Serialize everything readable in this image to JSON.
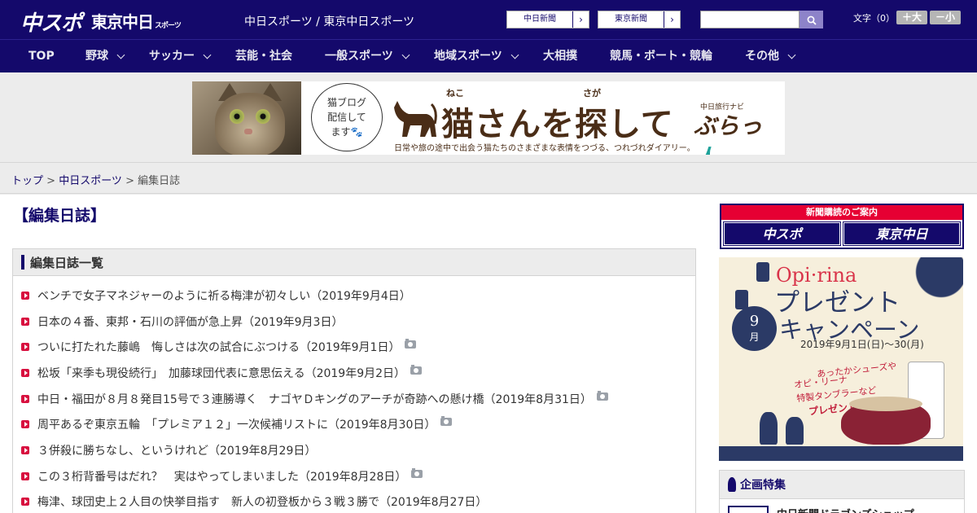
{
  "header": {
    "logo_chuspo": "中スポ",
    "logo_tokyo": "東京中日",
    "logo_tokyo_sub": "スポーツ",
    "site_title": "中日スポーツ / 東京中日スポーツ",
    "paper_links": [
      "中日新聞",
      "東京新聞"
    ],
    "search_placeholder": "",
    "font_size_label": "文字（0）",
    "font_bigger": "＋大",
    "font_smaller": "－小"
  },
  "nav": {
    "items": [
      {
        "label": "TOP",
        "dropdown": false
      },
      {
        "label": "野球",
        "dropdown": true
      },
      {
        "label": "サッカー",
        "dropdown": true
      },
      {
        "label": "芸能・社会",
        "dropdown": false
      },
      {
        "label": "一般スポーツ",
        "dropdown": true
      },
      {
        "label": "地域スポーツ",
        "dropdown": true
      },
      {
        "label": "大相撲",
        "dropdown": false
      },
      {
        "label": "競馬・ボート・競輪",
        "dropdown": false
      },
      {
        "label": "その他",
        "dropdown": true
      }
    ]
  },
  "banner": {
    "bubble_line1": "猫ブログ",
    "bubble_line2": "配信して",
    "bubble_line3": "ます🐾",
    "title": "猫さんを探して",
    "ruby_neko": "ねこ",
    "ruby_saga": "さが",
    "subtitle": "日常や旅の途中で出会う猫たちのさまざまな表情をつづる、つれづれダイアリー。",
    "nav_label": "中日旅行ナビ",
    "brand_a": "ぶらっ",
    "brand_b": "人"
  },
  "breadcrumb": {
    "top": "トップ",
    "section": "中日スポーツ",
    "current": "編集日誌",
    "sep": " > "
  },
  "main": {
    "title": "【編集日誌】",
    "list_header": "編集日誌一覧",
    "articles": [
      {
        "text": "ベンチで女子マネジャーのように祈る梅津が初々しい（2019年9月4日）",
        "photo": false
      },
      {
        "text": "日本の４番、東邦・石川の評価が急上昇（2019年9月3日）",
        "photo": false
      },
      {
        "text": "ついに打たれた藤嶋　悔しさは次の試合にぶつける（2019年9月1日）",
        "photo": true
      },
      {
        "text": "松坂「来季も現役続行」　加藤球団代表に意思伝える（2019年9月2日）",
        "photo": true
      },
      {
        "text": "中日・福田が８月８発目15号で３連勝導く　ナゴヤＤキングのアーチが奇跡への懸け橋（2019年8月31日）",
        "photo": true
      },
      {
        "text": "周平あるぞ東京五輪　「プレミア１２」一次候補リストに（2019年8月30日）",
        "photo": true
      },
      {
        "text": "３併殺に勝ちなし、というけれど（2019年8月29日）",
        "photo": false
      },
      {
        "text": "この３桁背番号はだれ？　実はやってしまいました（2019年8月28日）",
        "photo": true
      },
      {
        "text": "梅津、球団史上２人目の快挙目指す　新人の初登板から３戦３勝で（2019年8月27日）",
        "photo": false
      }
    ]
  },
  "sidebar": {
    "subscription_label": "新聞購読のご案内",
    "sub_logo_a": "中スポ",
    "sub_logo_b": "東京中日",
    "promo_brand": "Opi·rina",
    "promo_title1": "プレゼント",
    "promo_title2": "キャンペーン",
    "promo_month_num": "9",
    "promo_month_unit": "月",
    "promo_dates": "2019年9月1日(日)〜30(月)",
    "promo_line1": "あったかシューズや",
    "promo_line2": "オピ・リーナ",
    "promo_line3": "特製タンブラーなど",
    "promo_line4": "プレゼント!!",
    "feature_header": "企画特集",
    "feature_item": "中日新聞ドラゴンズショップ"
  },
  "colors": {
    "brand_navy": "#14096b",
    "accent_red": "#d8103f",
    "bg_gray": "#ececec"
  }
}
